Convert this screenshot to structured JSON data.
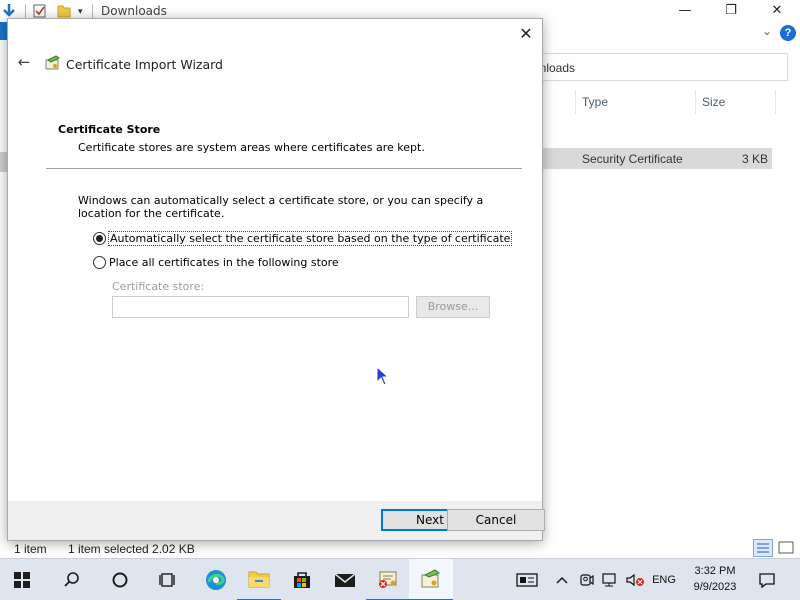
{
  "explorer": {
    "title": "Downloads",
    "search_text": "wnloads",
    "columns": {
      "type": "Type",
      "size": "Size"
    },
    "file": {
      "type": "Security Certificate",
      "size": "3 KB"
    },
    "status": {
      "count": "1 item",
      "selected": "1 item selected  2.02 KB"
    },
    "help": "?"
  },
  "dialog": {
    "wizard_title": "Certificate Import Wizard",
    "page_heading": "Certificate Store",
    "page_subtitle": "Certificate stores are system areas where certificates are kept.",
    "intro": "Windows can automatically select a certificate store, or you can specify a location for the certificate.",
    "options": {
      "auto": "Automatically select the certificate store based on the type of certificate",
      "place": "Place all certificates in the following store"
    },
    "selected_option": "auto",
    "store_label": "Certificate store:",
    "store_value": "",
    "browse_label": "Browse...",
    "next_label": "Next",
    "cancel_label": "Cancel"
  },
  "taskbar": {
    "language": "ENG",
    "time": "3:32 PM",
    "date": "9/9/2023",
    "icons": [
      "start-icon",
      "search-icon",
      "cortana-icon",
      "task-view-icon",
      "edge-icon",
      "file-explorer-icon",
      "store-icon",
      "mail-icon",
      "certificate-manager-icon",
      "certificate-wizard-icon"
    ]
  },
  "colors": {
    "accent": "#0078d7",
    "taskbar": "#dfe5ee",
    "selection": "#d9d9d9"
  }
}
